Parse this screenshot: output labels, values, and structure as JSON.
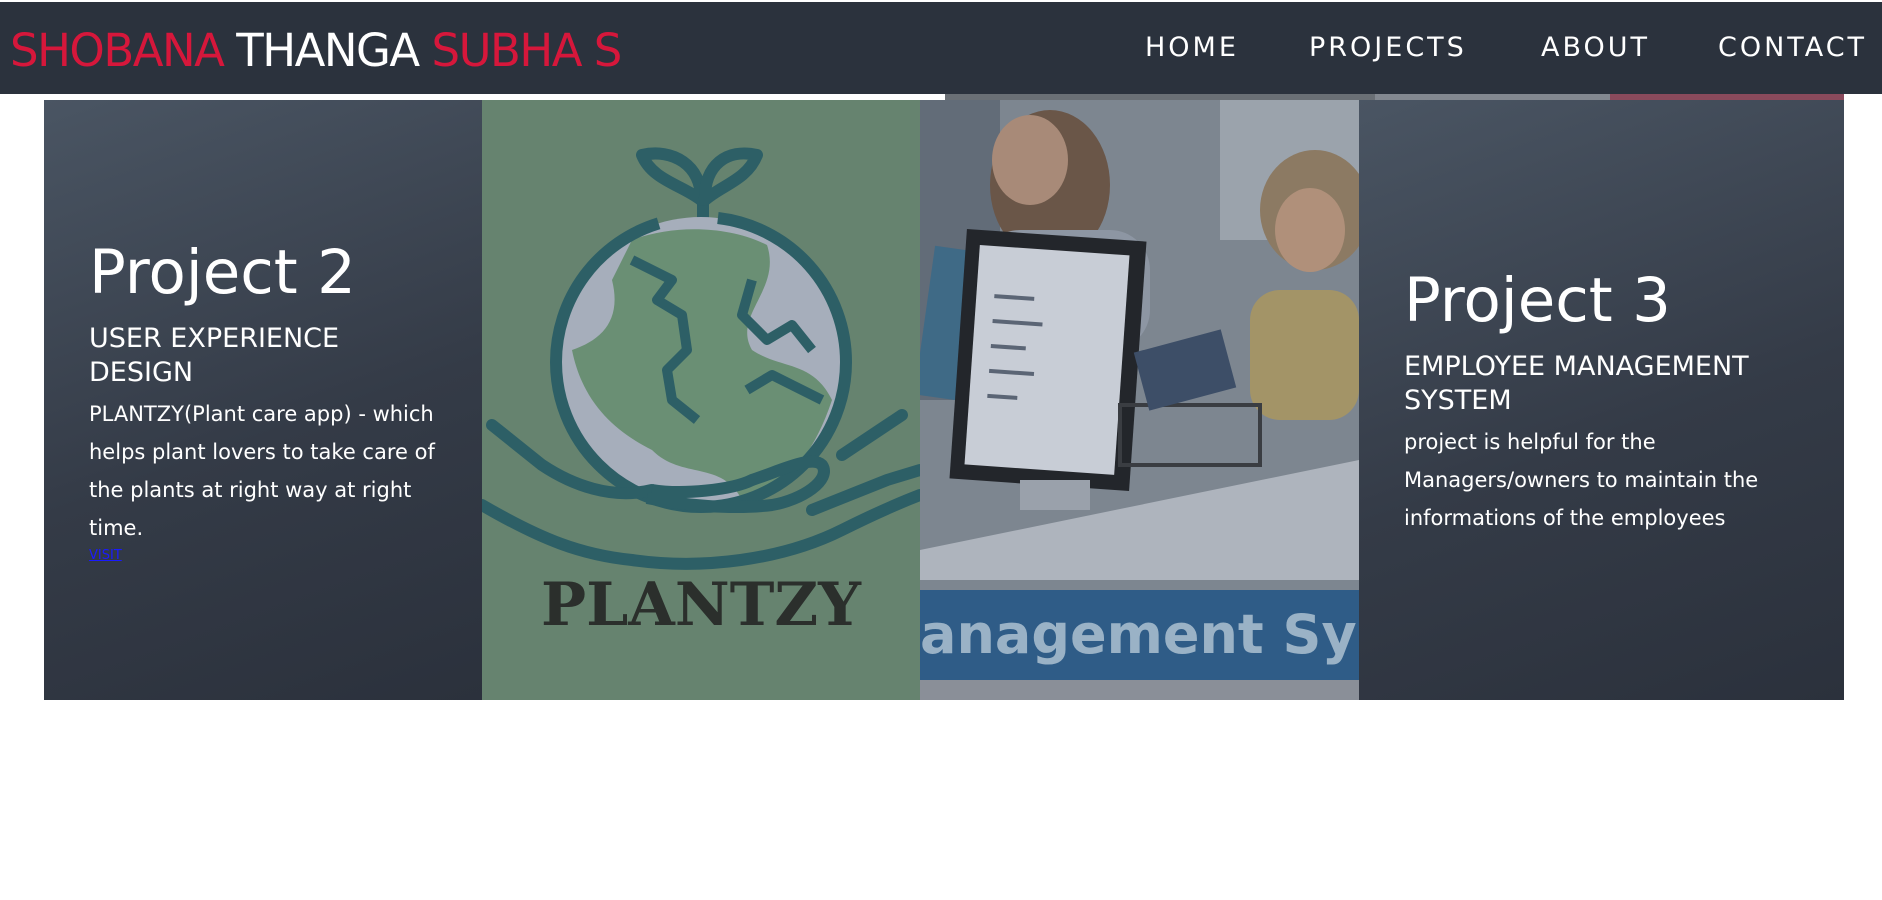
{
  "brand": {
    "first": "SHOBANA",
    "middle": "THANGA",
    "last": "SUBHA S",
    "accent_color": "#d6173b"
  },
  "nav": {
    "items": [
      {
        "label": "HOME"
      },
      {
        "label": "PROJECTS"
      },
      {
        "label": "ABOUT"
      },
      {
        "label": "CONTACT"
      }
    ]
  },
  "projects": [
    {
      "title": "Project 2",
      "subtitle": "USER EXPERIENCE DESIGN",
      "description": "PLANTZY(Plant care app) - which helps plant lovers to take care of the plants at right way at right time.",
      "link_label": "VISIT"
    },
    {
      "title": "Project 3",
      "subtitle": "EMPLOYEE MANAGEMENT SYSTEM",
      "description": "project is helpful for the Managers/owners to maintain the informations of the employees"
    }
  ],
  "images": {
    "plantzy_logo_text": "PLANTZY",
    "office_banner_text": "anagement Sys"
  }
}
